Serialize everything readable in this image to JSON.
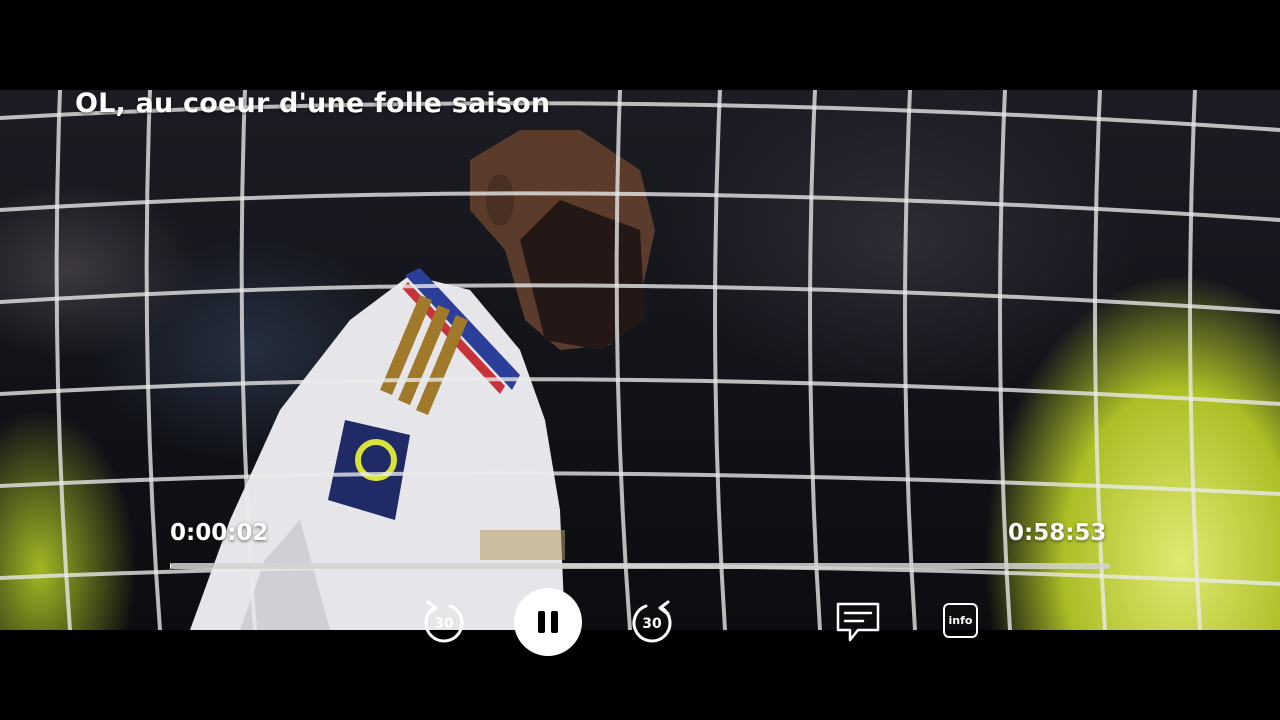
{
  "player": {
    "title": "OL, au coeur d'une folle saison",
    "elapsed": "0:00:02",
    "duration": "0:58:53",
    "progress_fraction": 0.0006
  },
  "controls": {
    "rewind_seconds": "30",
    "forward_seconds": "30",
    "play_state_icon": "pause-icon",
    "subtitles_icon": "subtitles-icon",
    "info_label": "info"
  },
  "colors": {
    "background": "#000000",
    "text": "#ffffff",
    "progress_track": "#d2d2d2"
  }
}
